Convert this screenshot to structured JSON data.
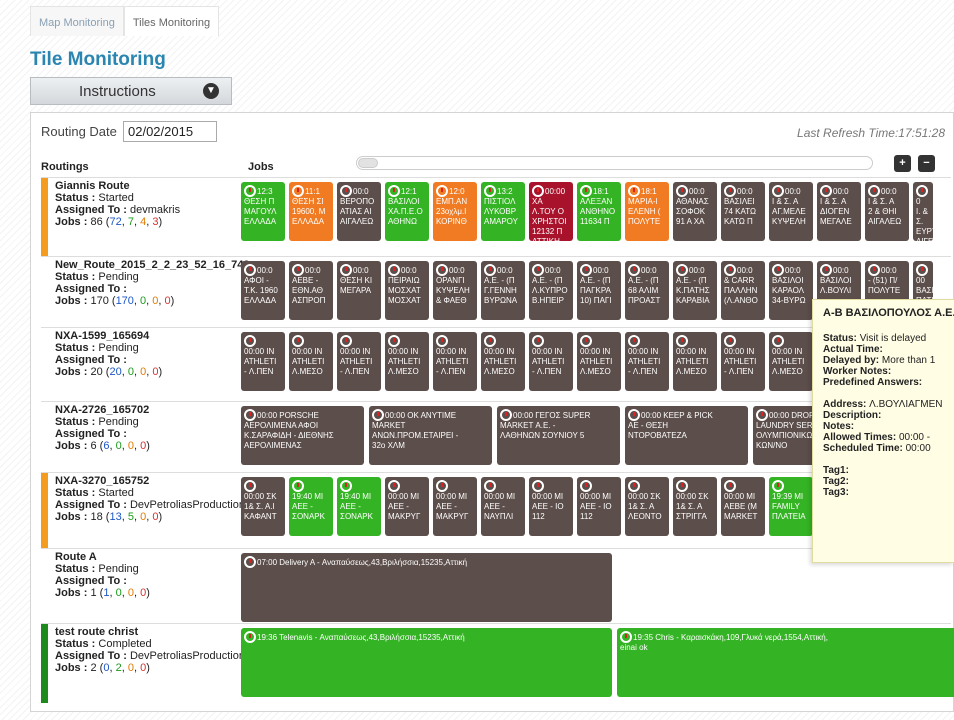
{
  "tabs": [
    {
      "label": "Map Monitoring",
      "active": false
    },
    {
      "label": "Tiles Monitoring",
      "active": true
    }
  ],
  "page_title": "Tile Monitoring",
  "instructions_label": "Instructions",
  "routing_date_label": "Routing Date",
  "routing_date_value": "02/02/2015",
  "last_refresh": "Last Refresh Time:17:51:28",
  "headers": {
    "routings": "Routings",
    "jobs": "Jobs"
  },
  "colors": {
    "started": "#f39c1f",
    "pending": "#ffffff",
    "completed": "#1e8a1e",
    "tile_grey": "#5c4e4a",
    "tile_green": "#34b424",
    "tile_orange": "#f07b23",
    "tile_red": "#a8132b",
    "title_blue": "#2a86b0"
  },
  "routes": [
    {
      "name": "Giannis Route",
      "status_label": "Status :",
      "status": "Started",
      "assigned_label": "Assigned To :",
      "assigned": "devmakris",
      "jobs_label": "Jobs :",
      "jobs_total": "86",
      "counts": [
        "72",
        "7",
        "4",
        "3"
      ],
      "tiles": [
        {
          "color": "green",
          "text": "12:3\nΘΕΣΗ Π\nΜΑΓΟΥΛ\nΕΛΛΑΔΑ"
        },
        {
          "color": "orange",
          "text": "11:1\nΘΕΣΗ ΣΙ\n19600, Μ\nΕΛΛΑΔΑ"
        },
        {
          "color": "grey",
          "text": "00:0\nΒΕΡΟΠΟ\nΑΤΙΑΣ ΑΙ\nΑΙΓΑΛΕΩ"
        },
        {
          "color": "green",
          "text": "12:1\nΒΑΣΙΛΟΙ\nΧΑ.Π.Ε.Ο\nΑΘΗΝΩ"
        },
        {
          "color": "orange",
          "text": "12:0\nΕΜΠ.ΑΝ\n23οχλμ.Ι\nΚΟΡΙΝΘ"
        },
        {
          "color": "green",
          "text": "13:2\nΠΙΣΤΙΟΛ\nΛΥΚΟΒΡ\nΑΜΑΡΟΥ"
        },
        {
          "color": "red",
          "text": "00:00 ΧΑ\nΛ.ΤΟΥ Ο\nΧΡΗΣΤΟΙ\n12132 Π\nΑΤΤΙΚΗ"
        },
        {
          "color": "green",
          "text": "18:1\nΑΛΕΞΑΝ\nΑΝΘΗΝΟ\n11634 Π"
        },
        {
          "color": "orange",
          "text": "18:1\nΜΑΡΙΑ-Ι\nΕΛΕΝΗ (\nΠΟΛΥΤΕ"
        },
        {
          "color": "grey",
          "text": "00:0\nΑΘΑΝΑΣ\nΣΟΦΟΚ\n91 Α ΧΑ"
        },
        {
          "color": "grey",
          "text": "00:0\nΒΑΣΙΛΕΙ\n74 ΚΑΤΩ\nΚΑΤΩ Π"
        },
        {
          "color": "grey",
          "text": "00:0\nΙ & Σ. Α\nΑΓ.ΜΕΛΕ\nΚΥΨΕΛΗ"
        },
        {
          "color": "grey",
          "text": "00:0\nΙ & Σ. Α\nΔΙΟΓΕΝ\nΜΕΓΑΛΕ"
        },
        {
          "color": "grey",
          "text": "00:0\nΙ & Σ. Α\n2 & ΘΗΙ\nΑΙΓΑΛΕΩ"
        },
        {
          "color": "grey",
          "text": "0\nΙ. & Σ.\nΕΥΡΥ\nΑΙΓΕ"
        }
      ]
    },
    {
      "name": "New_Route_2015_2_2_23_52_16_748",
      "status_label": "Status :",
      "status": "Pending",
      "assigned_label": "Assigned To :",
      "assigned": "",
      "jobs_label": "Jobs :",
      "jobs_total": "170",
      "counts": [
        "170",
        "0",
        "0",
        "0"
      ],
      "tiles": [
        {
          "color": "grey",
          "text": "00:0\nΑΦΟΙ -\nΤ.Κ. 1960\nΕΛΛΑΔΑ"
        },
        {
          "color": "grey",
          "text": "00:0\nΑΕΒΕ -\nΕΘΝ.ΑΘ\nΑΣΠΡΟΠ"
        },
        {
          "color": "grey",
          "text": "00:0\nΘΕΣΗ ΚΙ\nΜΕΓΑΡΑ"
        },
        {
          "color": "grey",
          "text": "00:0\nΠΕΙΡΑΙΩ\nΜΟΣΧΑΤ\nΜΟΣΧΑΤ"
        },
        {
          "color": "grey",
          "text": "00:0\nΟΡΑΝΓΙ\nΚΥΨΕΛΗ\n& ΦΑΕΘ"
        },
        {
          "color": "grey",
          "text": "00:0\nΑ.Ε. - (Π\nΓ.ΓΕΝΝΗ\nΒΥΡΩΝΑ"
        },
        {
          "color": "grey",
          "text": "00:0\nΑ.Ε. - (Π\nΛ.ΚΥΠΡΟ\nΒ.ΗΠΕΙΡ"
        },
        {
          "color": "grey",
          "text": "00:0\nΑ.Ε. - (Π\nΠΑΓΚΡΑ\n10) ΠΑΓΙ"
        },
        {
          "color": "grey",
          "text": "00:0\nΑ.Ε. - (Π\n68 ΑΛΙΜ\nΠΡΟΑΣΤ"
        },
        {
          "color": "grey",
          "text": "00:0\nΑ.Ε. - (Π\nΚ.ΠΑΤΗΣ\nΚΑΡΑΒΙΑ"
        },
        {
          "color": "grey",
          "text": "00:0\n& CARR\nΠΑΛΛΗΝ\n(Λ.ΑΝΘΟ"
        },
        {
          "color": "grey",
          "text": "00:0\nΒΑΣΙΛΟΙ\nΚΑΡΑΟΛ\n34-ΒΥΡΩ"
        },
        {
          "color": "grey",
          "text": "00:0\nΒΑΣΙΛΟΙ\nΛ.ΒΟΥΛΙ"
        },
        {
          "color": "grey",
          "text": "00:0\n- (51) Π/\nΠΟΛΥΤΕ"
        },
        {
          "color": "grey",
          "text": "00\nΒΑΣΙ\nΠΑΤΗ"
        }
      ]
    },
    {
      "name": "NXA-1599_165694",
      "status_label": "Status :",
      "status": "Pending",
      "assigned_label": "Assigned To :",
      "assigned": "",
      "jobs_label": "Jobs :",
      "jobs_total": "20",
      "counts": [
        "20",
        "0",
        "0",
        "0"
      ],
      "tiles": [
        {
          "color": "grey",
          "text": "\n00:00 IN\nATHLETI\n- Λ.ΠΕΝ"
        },
        {
          "color": "grey",
          "text": "\n00:00 IN\nATHLETI\nΛ.ΜΕΣΟ"
        },
        {
          "color": "grey",
          "text": "\n00:00 IN\nATHLETI\n- Λ.ΠΕΝ"
        },
        {
          "color": "grey",
          "text": "\n00:00 IN\nATHLETI\nΛ.ΜΕΣΟ"
        },
        {
          "color": "grey",
          "text": "\n00:00 IN\nATHLETI\n- Λ.ΠΕΝ"
        },
        {
          "color": "grey",
          "text": "\n00:00 IN\nATHLETI\nΛ.ΜΕΣΟ"
        },
        {
          "color": "grey",
          "text": "\n00:00 IN\nATHLETI\n- Λ.ΠΕΝ"
        },
        {
          "color": "grey",
          "text": "\n00:00 IN\nATHLETI\nΛ.ΜΕΣΟ"
        },
        {
          "color": "grey",
          "text": "\n00:00 IN\nATHLETI\n- Λ.ΠΕΝ"
        },
        {
          "color": "grey",
          "text": "\n00:00 IN\nATHLETI\nΛ.ΜΕΣΟ"
        },
        {
          "color": "grey",
          "text": "\n00:00 IN\nATHLETI\n- Λ.ΠΕΝ"
        },
        {
          "color": "grey",
          "text": "\n00:00 IN\nATHLETI\nΛ.ΜΕΣΟ"
        }
      ]
    },
    {
      "name": "NXA-2726_165702",
      "status_label": "Status :",
      "status": "Pending",
      "assigned_label": "Assigned To :",
      "assigned": "",
      "jobs_label": "Jobs :",
      "jobs_total": "6",
      "counts": [
        "6",
        "0",
        "0",
        "0"
      ],
      "tiles": [
        {
          "color": "grey",
          "text": "00:00 PORSCHE\nΑΕΡΟΛΙΜΕΝΑ ΑΦΟΙ\nΚ.ΣΑΡΑΦΙΔΗ - ΔΙΕΘΝΗΣ\nΑΕΡΟΛΙΜΕΝΑΣ"
        },
        {
          "color": "grey",
          "text": "00:00 OK ANYTIME\nMARKET\nΑΝΩΝ.ΠΡΟΜ.ΕΤΑΙΡΕΙ -\n32ο ΧΛΜ"
        },
        {
          "color": "grey",
          "text": "00:00 ΓΕΓΟΣ SUPER\nMARKET Α.Ε. -\nΛΑΘΗΝΩΝ ΣΟΥΝΙΟΥ 5"
        },
        {
          "color": "grey",
          "text": "00:00 KEEP & PICK\nΑΕ - ΘΕΣΗ\nΝΤΟΡΟΒΑΤΕΖΑ"
        },
        {
          "color": "grey",
          "text": "00:00 DROP\nLAUNDRY SERV\nΟΛΥΜΠΙΟΝΙΚΩ\nΚΩΝ/ΝΟ"
        }
      ]
    },
    {
      "name": "NXA-3270_165752",
      "status_label": "Status :",
      "status": "Started",
      "assigned_label": "Assigned To :",
      "assigned": "DevPetroliasProduction",
      "jobs_label": "Jobs :",
      "jobs_total": "18",
      "counts": [
        "13",
        "5",
        "0",
        "0"
      ],
      "tiles": [
        {
          "color": "grey",
          "text": "\n00:00 ΣΚ\n1& Σ. Α.Ι\nΚΑΦΑΝΤ"
        },
        {
          "color": "green",
          "text": "\n19:40 ΜΙ\nΑΕΕ -\nΣΟΝΑΡΚ"
        },
        {
          "color": "green",
          "text": "\n19:40 ΜΙ\nΑΕΕ -\nΣΟΝΑΡΚ"
        },
        {
          "color": "grey",
          "text": "\n00:00 ΜΙ\nΑΕΕ -\nΜΑΚΡΥΓ"
        },
        {
          "color": "grey",
          "text": "\n00:00 ΜΙ\nΑΕΕ -\nΜΑΚΡΥΓ"
        },
        {
          "color": "grey",
          "text": "\n00:00 ΜΙ\nΑΕΕ -\nΝΑΥΠΛΙ"
        },
        {
          "color": "grey",
          "text": "\n00:00 ΜΙ\nΑΕΕ - ΙΟ\n112"
        },
        {
          "color": "grey",
          "text": "\n00:00 ΜΙ\nΑΕΕ - ΙΟ\n112"
        },
        {
          "color": "grey",
          "text": "\n00:00 ΣΚ\n1& Σ. Α\nΛΕΟΝΤΟ"
        },
        {
          "color": "grey",
          "text": "\n00:00 ΣΚ\n1& Σ. Α\nΣΤΡΙΓΓΑ"
        },
        {
          "color": "grey",
          "text": "\n00:00 ΜΙ\nΑΕΒΕ (Μ\nMARKET"
        },
        {
          "color": "green",
          "text": "\n19:39 ΜΙ\nFAMILY\nΠΛΑΤΕΙΑ"
        }
      ]
    },
    {
      "name": "Route A",
      "status_label": "Status :",
      "status": "Pending",
      "assigned_label": "Assigned To :",
      "assigned": "",
      "jobs_label": "Jobs :",
      "jobs_total": "1",
      "counts": [
        "1",
        "0",
        "0",
        "0"
      ],
      "tiles": [
        {
          "color": "grey",
          "text": "07:00 Delivery A - Αναπαύσεως,43,Βριλήσσια,15235,Αττική"
        }
      ]
    },
    {
      "name": "test route christ",
      "status_label": "Status :",
      "status": "Completed",
      "assigned_label": "Assigned To :",
      "assigned": "DevPetroliasProduction",
      "jobs_label": "Jobs :",
      "jobs_total": "2",
      "counts": [
        "0",
        "2",
        "0",
        "0"
      ],
      "tiles": [
        {
          "color": "green",
          "text": "19:36 Telenavis - Αναπαύσεως,43,Βριλήσσια,15235,Αττική"
        },
        {
          "color": "green",
          "text": "19:35 Chris - Καραισκάκη,109,Γλυκά νερά,1554,Αττική,\neinai ok"
        }
      ]
    }
  ],
  "tooltip": {
    "title": "Α-Β ΒΑΣΙΛΟΠΟΥΛΟΣ Α.Ε.",
    "status_label": "Status:",
    "status": "Visit is delayed",
    "actual_time_label": "Actual Time:",
    "delayed_by_label": "Delayed by:",
    "delayed_by": "More than 1",
    "worker_notes_label": "Worker Notes:",
    "predefined_answers_label": "Predefined Answers:",
    "address_label": "Address:",
    "address": "Λ.ΒΟΥΛΙΑΓΜΕΝ",
    "description_label": "Description:",
    "notes_label": "Notes:",
    "allowed_times_label": "Allowed Times:",
    "allowed_times": "00:00 -",
    "scheduled_time_label": "Scheduled Time:",
    "scheduled_time": "00:00",
    "tag1_label": "Tag1:",
    "tag2_label": "Tag2:",
    "tag3_label": "Tag3:"
  }
}
